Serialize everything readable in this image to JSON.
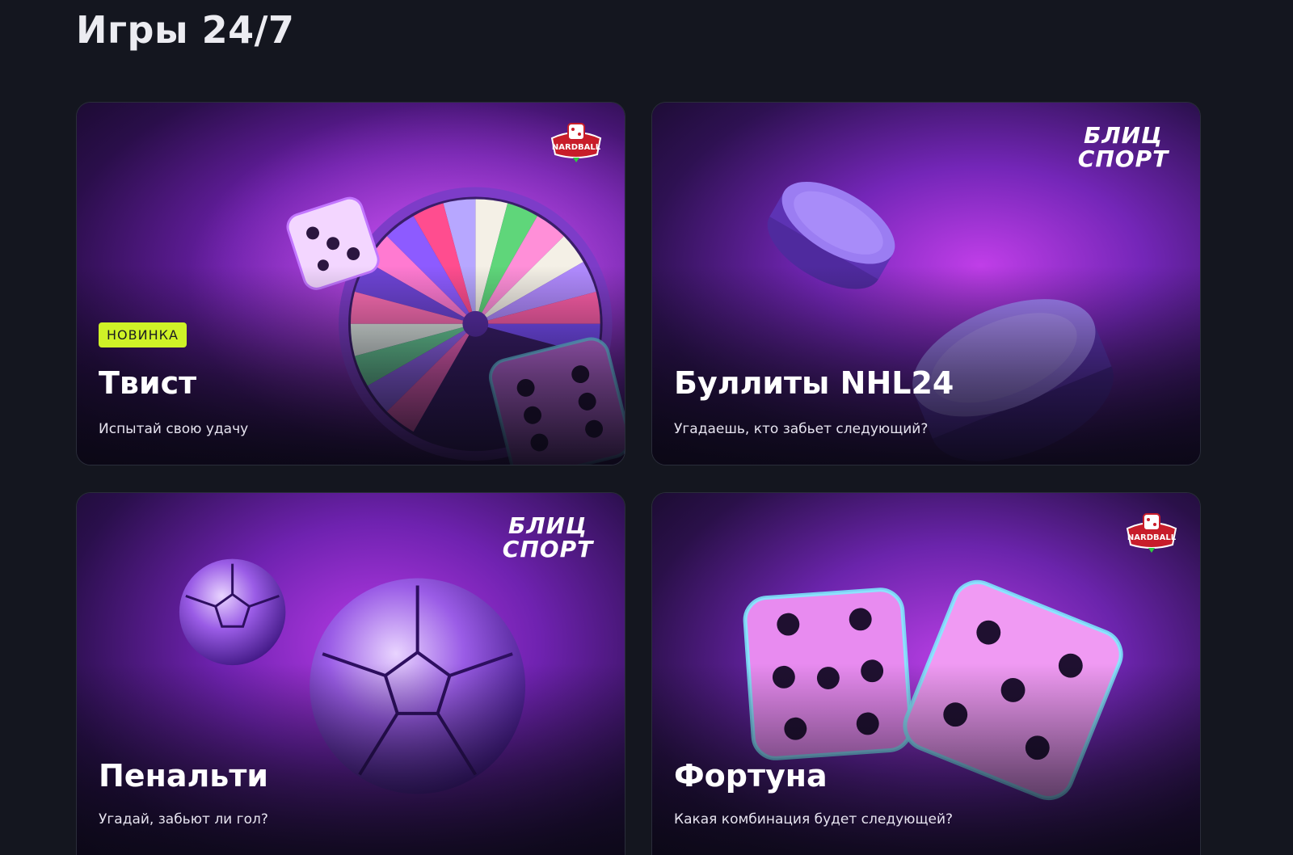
{
  "page": {
    "title": "Игры 24/7"
  },
  "cards": [
    {
      "title": "Твист",
      "subtitle": "Испытай свою удачу",
      "badge": "НОВИНКА",
      "logo": "NARDBALL"
    },
    {
      "title": "Буллиты NHL24",
      "subtitle": "Угадаешь, кто забьет следующий?",
      "logo_line1": "БЛИЦ",
      "logo_line2": "СПОРТ"
    },
    {
      "title": "Пенальти",
      "subtitle": "Угадай, забьют ли гол?",
      "logo_line1": "БЛИЦ",
      "logo_line2": "СПОРТ"
    },
    {
      "title": "Фортуна",
      "subtitle": "Какая комбинация будет следующей?",
      "logo": "NARDBALL"
    }
  ],
  "colors": {
    "background": "#14161f",
    "badge": "#cff227",
    "card_purple": "#8a2fd6"
  }
}
